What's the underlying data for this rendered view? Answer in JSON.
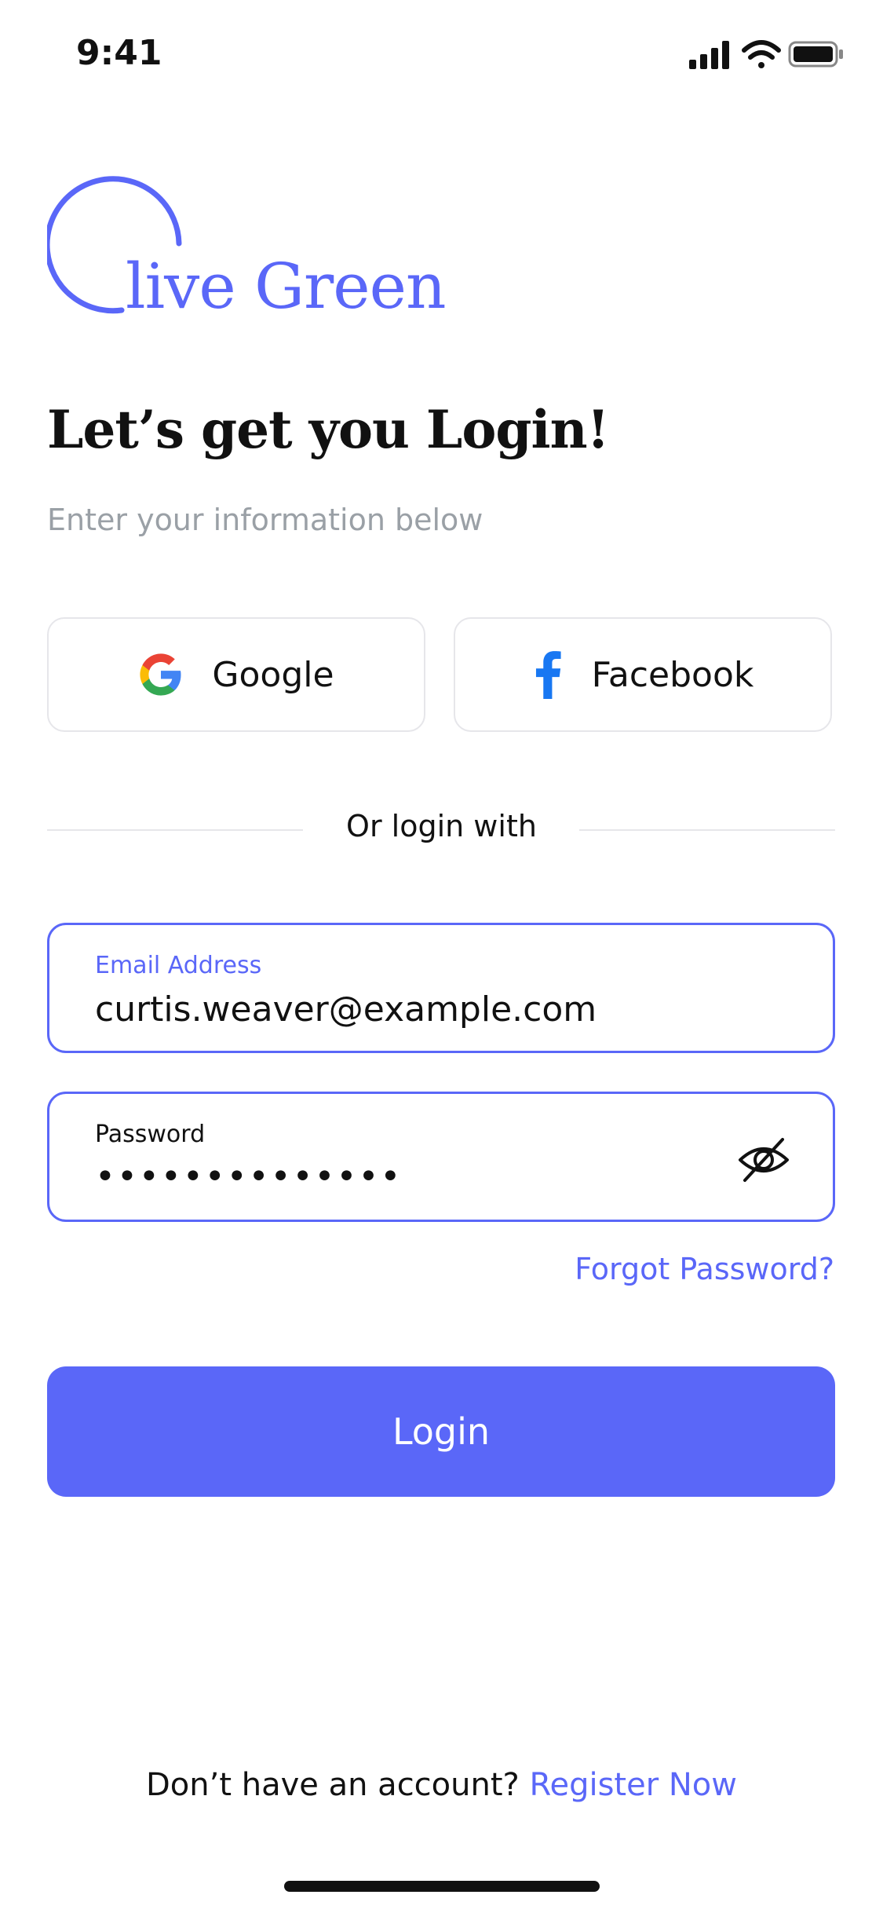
{
  "status_bar": {
    "time": "9:41",
    "icons": [
      "signal-icon",
      "wifi-icon",
      "battery-icon"
    ]
  },
  "logo": {
    "text": "live Green",
    "color": "#5A67F8"
  },
  "heading": "Let’s get you Login!",
  "subheading": "Enter your information below",
  "social": {
    "google_label": "Google",
    "facebook_label": "Facebook"
  },
  "divider_text": "Or login with",
  "email": {
    "label": "Email Address",
    "value": "curtis.weaver@example.com"
  },
  "password": {
    "label": "Password",
    "value": "••••••••••••••"
  },
  "forgot_password": "Forgot Password?",
  "login_button": "Login",
  "register": {
    "prompt": "Don’t have an account?",
    "link": "Register Now"
  },
  "colors": {
    "accent": "#5A67F8",
    "google_blue": "#4285F4",
    "google_red": "#EA4335",
    "google_yellow": "#FBBC05",
    "google_green": "#34A853",
    "facebook_blue": "#1877F2"
  }
}
